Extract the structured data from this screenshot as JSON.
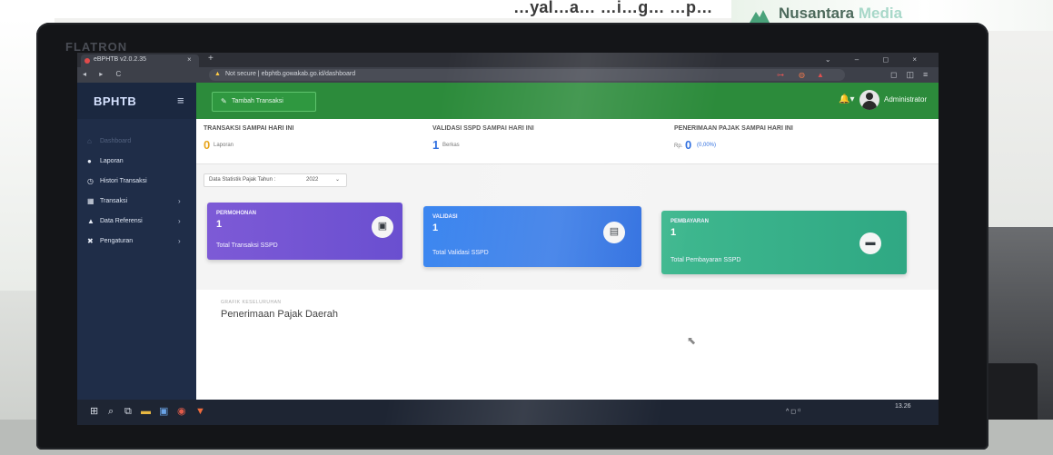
{
  "environment": {
    "top_banner_text": "…yal…a… …i…g… …p…",
    "poster_brand_a": "Nusantara",
    "poster_brand_b": "Media",
    "monitor_brand": "FLATRON"
  },
  "browser": {
    "tab_title": "eBPHTB v2.0.2.35",
    "tab_close": "×",
    "new_tab": "+",
    "security_label": "Not secure",
    "url": "ebphtb.gowakab.go.id/dashboard",
    "nav_icons": "◂ ▸ C",
    "window_controls": "⌄ – ◻ ×"
  },
  "sidebar": {
    "brand": "BPHTB",
    "toggle_icon": "≡",
    "items": [
      {
        "icon": "⌂",
        "label": "Dashboard",
        "active": true,
        "caret": ""
      },
      {
        "icon": "●",
        "label": "Laporan",
        "caret": ""
      },
      {
        "icon": "◷",
        "label": "Histori Transaksi",
        "caret": ""
      },
      {
        "icon": "▦",
        "label": "Transaksi",
        "caret": "›"
      },
      {
        "icon": "▲",
        "label": "Data Referensi",
        "caret": "›"
      },
      {
        "icon": "✖",
        "label": "Pengaturan",
        "caret": "›"
      }
    ]
  },
  "topbar": {
    "add_button_icon": "✎",
    "add_button_label": "Tambah Transaksi",
    "bell_icon": "🔔▾",
    "username": "Administrator"
  },
  "stats": [
    {
      "title": "TRANSAKSI SAMPAI HARI INI",
      "value": "0",
      "unit": "Laporan"
    },
    {
      "title": "VALIDASI SSPD SAMPAI HARI INI",
      "value": "1",
      "unit": "Berkas"
    },
    {
      "title": "PENERIMAAN PAJAK SAMPAI HARI INI",
      "prefix": "Rp.",
      "value": "0",
      "pct": "(0,00%)"
    }
  ],
  "filter": {
    "label": "Data Statistik Pajak Tahun :",
    "year": "2022",
    "caret": "⌄"
  },
  "cards": [
    {
      "title": "PERMOHONAN",
      "value": "1",
      "subtitle": "Total Transaksi SSPD",
      "icon": "▣",
      "color": "#6a4fd0"
    },
    {
      "title": "VALIDASI",
      "value": "1",
      "subtitle": "Total Validasi SSPD",
      "icon": "▤",
      "color": "#2f6fe0"
    },
    {
      "title": "PEMBAYARAN",
      "value": "1",
      "subtitle": "Total Pembayaran SSPD",
      "icon": "▬",
      "color": "#2fa883"
    }
  ],
  "chart_panel": {
    "kicker": "GRAFIK KESELURUHAN",
    "title": "Penerimaan Pajak Daerah"
  },
  "taskbar": {
    "tray_text": "^ ◻ ⁽⁽",
    "clock": "13.26"
  },
  "colors": {
    "sidebar": "#1f2d48",
    "topbar": "#2c8b3b",
    "stat_accent": "#e7a51e"
  }
}
